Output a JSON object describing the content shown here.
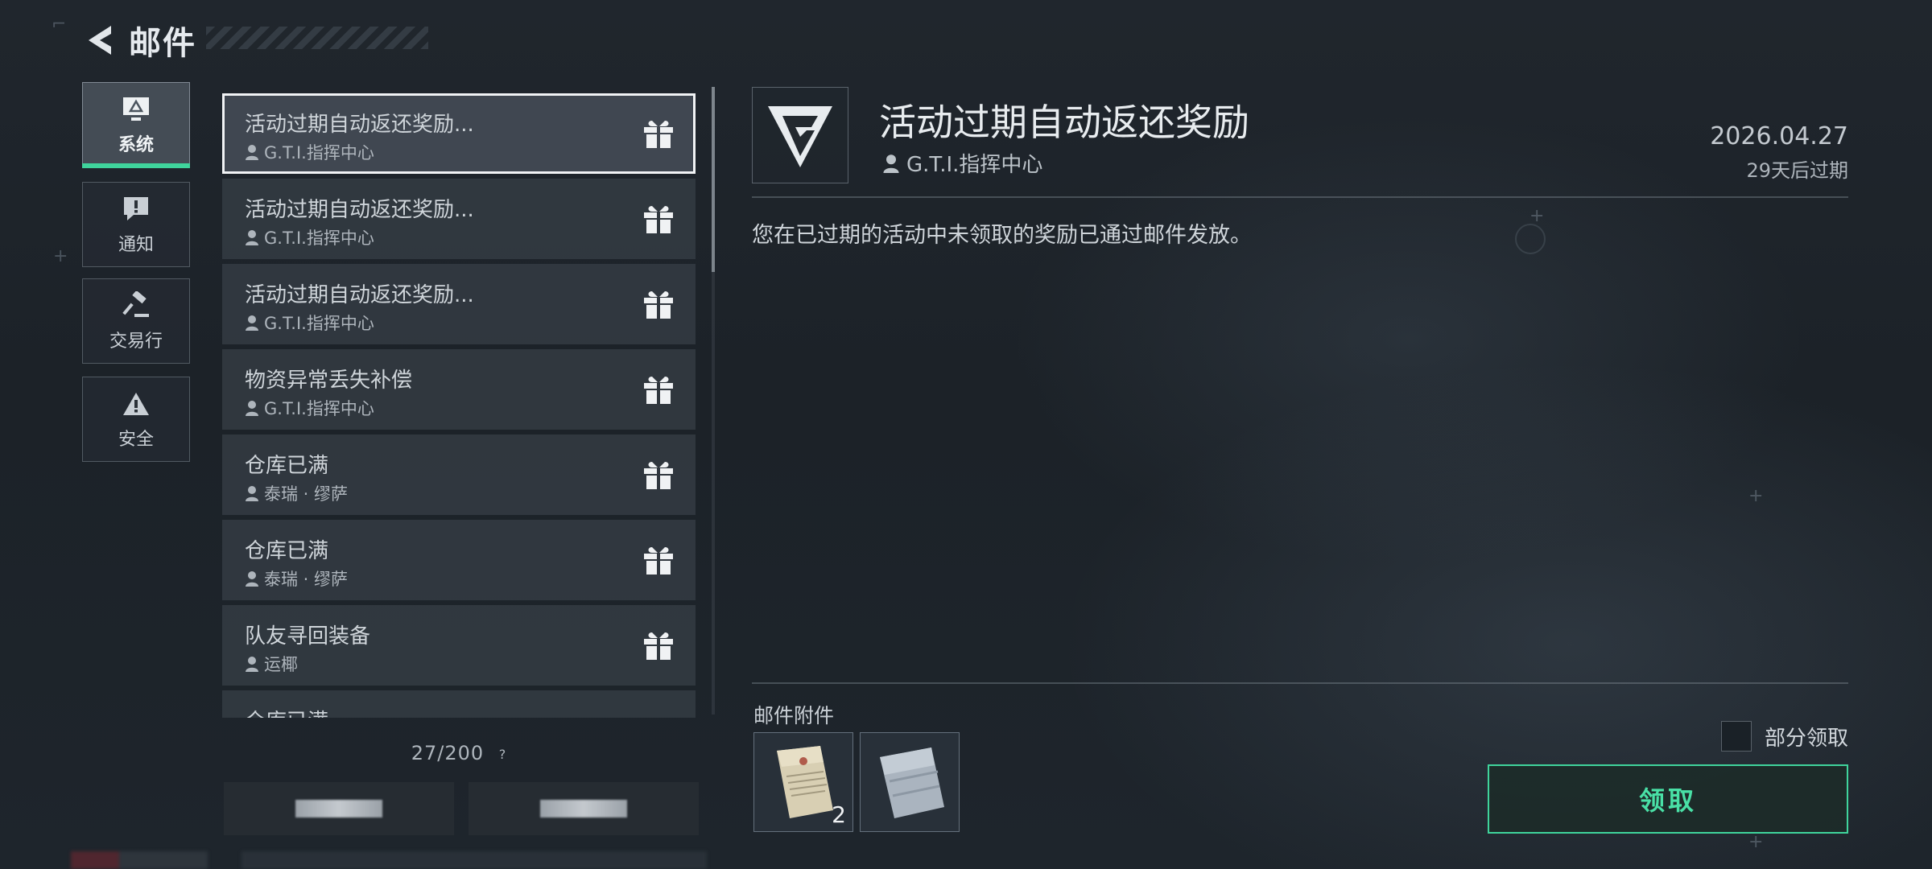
{
  "header": {
    "title": "邮件"
  },
  "categories": [
    {
      "label": "系统",
      "icon": "monitor-icon",
      "active": true
    },
    {
      "label": "通知",
      "icon": "message-alert-icon",
      "active": false
    },
    {
      "label": "交易行",
      "icon": "gavel-icon",
      "active": false
    },
    {
      "label": "安全",
      "icon": "warning-triangle-icon",
      "active": false
    }
  ],
  "mails": [
    {
      "title": "活动过期自动返还奖励...",
      "sender": "G.T.I.指挥中心",
      "icon": "gift-icon",
      "selected": true
    },
    {
      "title": "活动过期自动返还奖励...",
      "sender": "G.T.I.指挥中心",
      "icon": "gift-icon"
    },
    {
      "title": "活动过期自动返还奖励...",
      "sender": "G.T.I.指挥中心",
      "icon": "gift-icon"
    },
    {
      "title": "物资异常丢失补偿",
      "sender": "G.T.I.指挥中心",
      "icon": "gift-icon"
    },
    {
      "title": "仓库已满",
      "sender": "泰瑞 · 缪萨",
      "icon": "gift-icon"
    },
    {
      "title": "仓库已满",
      "sender": "泰瑞 · 缪萨",
      "icon": "gift-icon"
    },
    {
      "title": "队友寻回装备",
      "sender": "运椰",
      "icon": "gift-icon"
    },
    {
      "title": "仓库已满",
      "sender": "",
      "icon": "gift-icon"
    }
  ],
  "mail_count": {
    "text": "27/200",
    "help": "?"
  },
  "detail": {
    "logo": "gti-logo",
    "title": "活动过期自动返还奖励",
    "sender": "G.T.I.指挥中心",
    "date": "2026.04.27",
    "expire": "29天后过期",
    "body": "您在已过期的活动中未领取的奖励已通过邮件发放。",
    "attachments_label": "邮件附件",
    "attachments": [
      {
        "item": "document-item-icon",
        "quantity": "2"
      },
      {
        "item": "cloth-item-icon",
        "quantity": ""
      }
    ],
    "partial_claim_label": "部分领取",
    "claim_label": "领取"
  },
  "colors": {
    "accent": "#3fd49c",
    "background": "#1e252c",
    "panel": "#363d45",
    "text": "#d7dde2"
  }
}
